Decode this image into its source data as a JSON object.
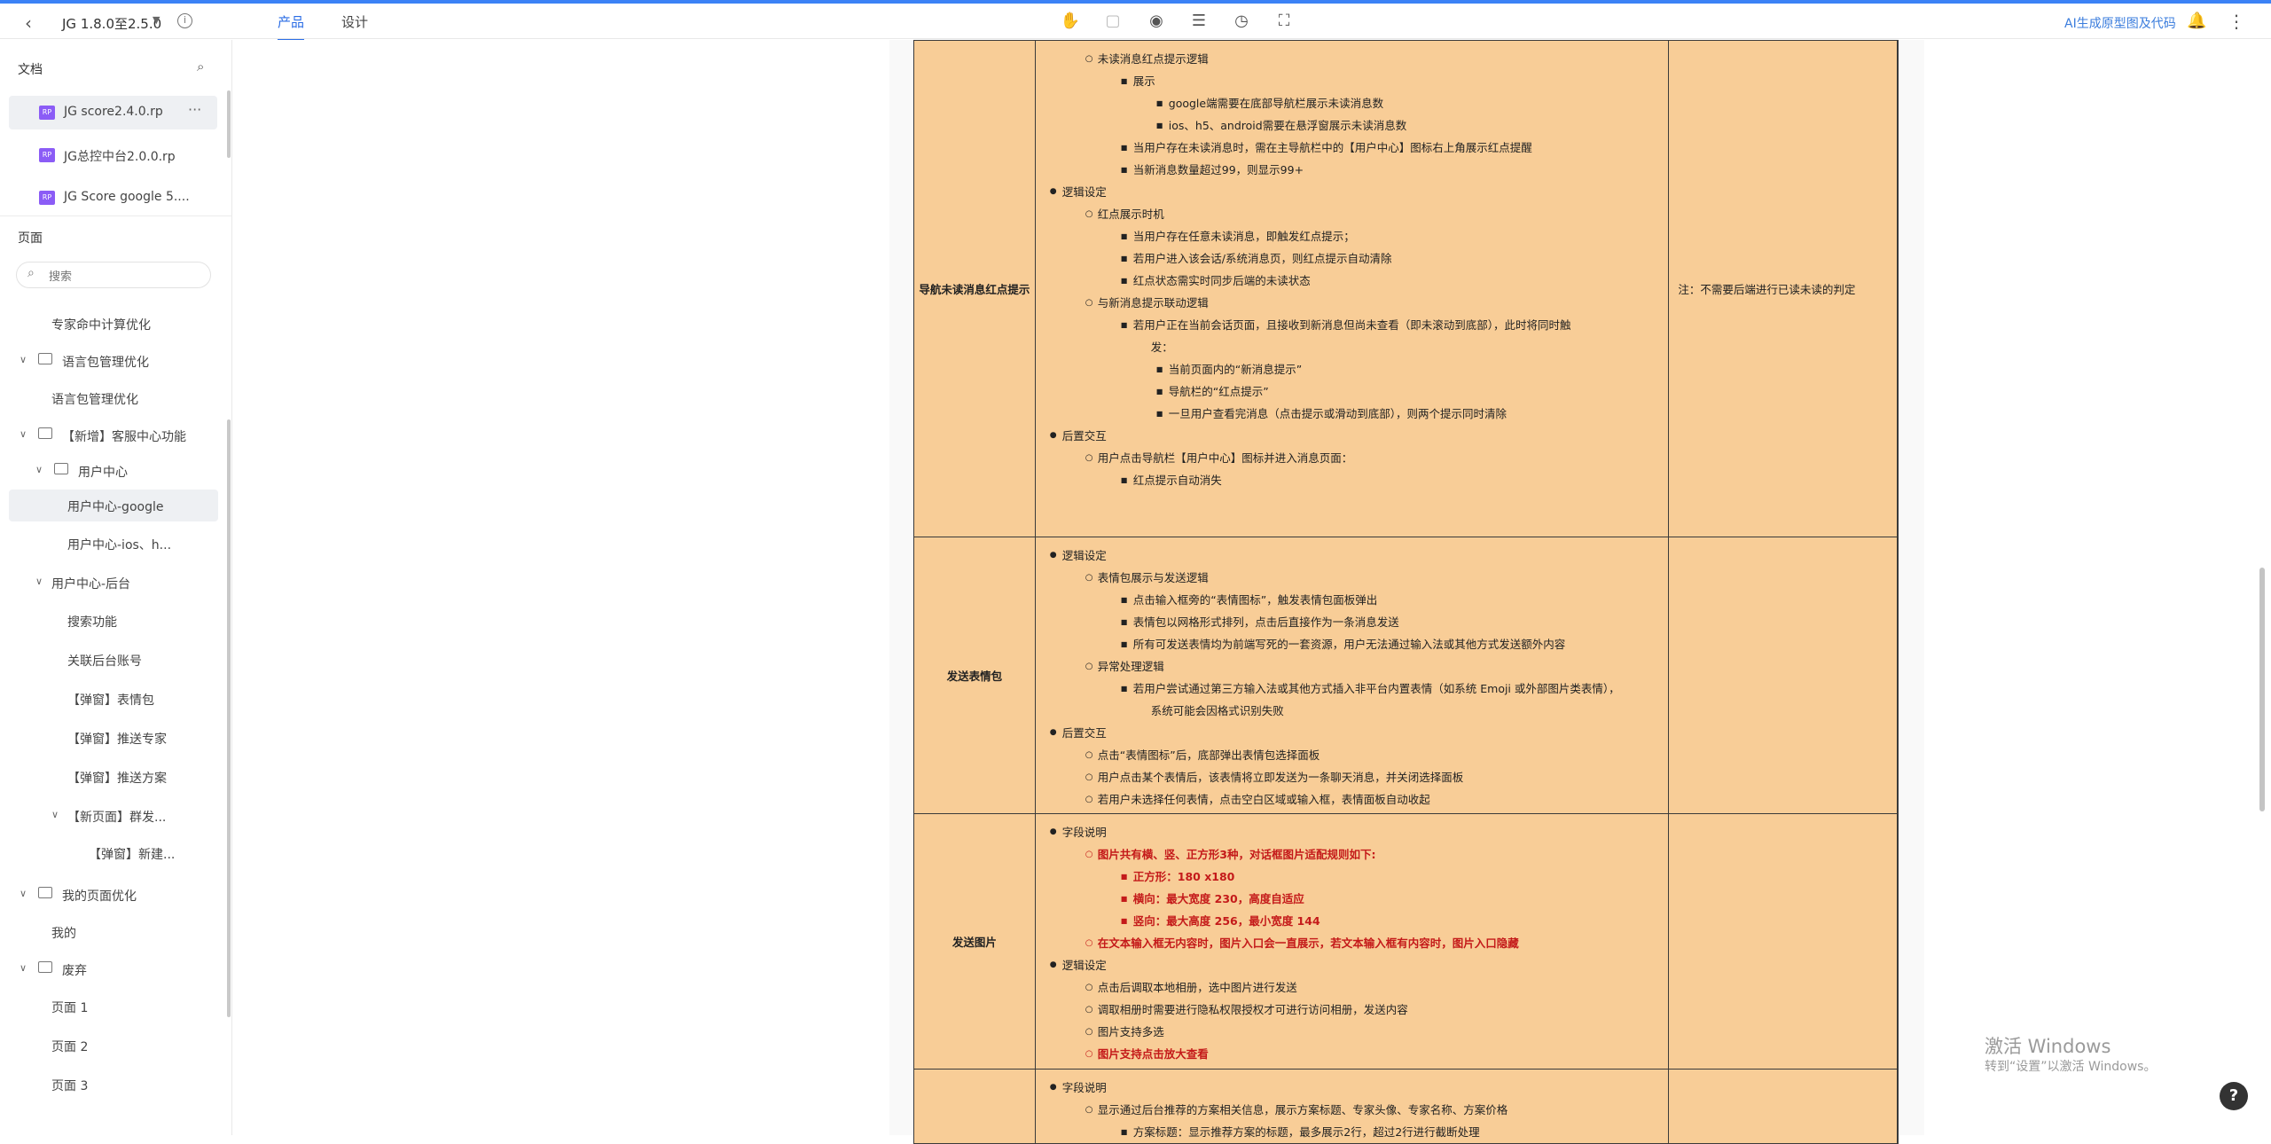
{
  "topbar": {
    "doc_title": "JG 1.8.0至2.5.0",
    "tabs": [
      "产品",
      "设计"
    ],
    "ai_link": "AI生成原型图及代码"
  },
  "sidebar": {
    "docs_heading": "文档",
    "files": [
      {
        "badge": "RP",
        "label": "JG score2.4.0.rp"
      },
      {
        "badge": "RP",
        "label": "JG总控中台2.0.0.rp"
      },
      {
        "badge": "RP",
        "label": "JG Score google 5...."
      }
    ],
    "pages_heading": "页面",
    "search_placeholder": "搜索",
    "tree": [
      {
        "label": "专家命中计算优化"
      },
      {
        "label": "语言包管理优化"
      },
      {
        "label": "语言包管理优化"
      },
      {
        "label": "【新增】客服中心功能"
      },
      {
        "label": "用户中心"
      },
      {
        "label": "用户中心-google"
      },
      {
        "label": "用户中心-ios、h..."
      },
      {
        "label": "用户中心-后台"
      },
      {
        "label": "搜索功能"
      },
      {
        "label": "关联后台账号"
      },
      {
        "label": "【弹窗】表情包"
      },
      {
        "label": "【弹窗】推送专家"
      },
      {
        "label": "【弹窗】推送方案"
      },
      {
        "label": "【新页面】群发..."
      },
      {
        "label": "【弹窗】新建..."
      },
      {
        "label": "我的页面优化"
      },
      {
        "label": "我的"
      },
      {
        "label": "废弃"
      },
      {
        "label": "页面 1"
      },
      {
        "label": "页面 2"
      },
      {
        "label": "页面 3"
      }
    ]
  },
  "table": {
    "rows": [
      {
        "name": "导航未读消息红点提示",
        "note": "注：不需要后端进行已读未读的判定",
        "lines": [
          {
            "lvl": 2,
            "text": "未读消息红点提示逻辑"
          },
          {
            "lvl": 3,
            "text": "展示"
          },
          {
            "lvl": 4,
            "text": "google端需要在底部导航栏展示未读消息数"
          },
          {
            "lvl": 4,
            "text": "ios、h5、android需要在悬浮窗展示未读消息数"
          },
          {
            "lvl": 3,
            "text": "当用户存在未读消息时，需在主导航栏中的【用户中心】图标右上角展示红点提醒"
          },
          {
            "lvl": 3,
            "text": "当新消息数量超过99，则显示99+"
          },
          {
            "lvl": 1,
            "text": "逻辑设定"
          },
          {
            "lvl": 2,
            "text": "红点展示时机"
          },
          {
            "lvl": 3,
            "text": "当用户存在任意未读消息，即触发红点提示；"
          },
          {
            "lvl": 3,
            "text": "若用户进入该会话/系统消息页，则红点提示自动清除"
          },
          {
            "lvl": 3,
            "text": "红点状态需实时同步后端的未读状态"
          },
          {
            "lvl": 2,
            "text": "与新消息提示联动逻辑"
          },
          {
            "lvl": 3,
            "text": "若用户正在当前会话页面，且接收到新消息但尚未查看（即未滚动到底部），此时将同时触"
          },
          {
            "lvl": 5,
            "text": "发："
          },
          {
            "lvl": 4,
            "text": "当前页面内的“新消息提示”"
          },
          {
            "lvl": 4,
            "text": "导航栏的“红点提示”"
          },
          {
            "lvl": 4,
            "text": "一旦用户查看完消息（点击提示或滑动到底部），则两个提示同时清除"
          },
          {
            "lvl": 1,
            "text": "后置交互"
          },
          {
            "lvl": 2,
            "text": "用户点击导航栏【用户中心】图标并进入消息页面："
          },
          {
            "lvl": 3,
            "text": "红点提示自动消失"
          }
        ]
      },
      {
        "name": "发送表情包",
        "note": "",
        "lines": [
          {
            "lvl": 1,
            "text": "逻辑设定"
          },
          {
            "lvl": 2,
            "text": "表情包展示与发送逻辑"
          },
          {
            "lvl": 3,
            "text": "点击输入框旁的“表情图标”，触发表情包面板弹出"
          },
          {
            "lvl": 3,
            "text": "表情包以网格形式排列，点击后直接作为一条消息发送"
          },
          {
            "lvl": 3,
            "text": "所有可发送表情均为前端写死的一套资源，用户无法通过输入法或其他方式发送额外内容"
          },
          {
            "lvl": 2,
            "text": "异常处理逻辑"
          },
          {
            "lvl": 3,
            "text": "若用户尝试通过第三方输入法或其他方式插入非平台内置表情（如系统 Emoji 或外部图片类表情），"
          },
          {
            "lvl": 5,
            "text": "系统可能会因格式识别失败"
          },
          {
            "lvl": 1,
            "text": "后置交互"
          },
          {
            "lvl": 2,
            "text": "点击“表情图标”后，底部弹出表情包选择面板"
          },
          {
            "lvl": 2,
            "text": "用户点击某个表情后，该表情将立即发送为一条聊天消息，并关闭选择面板"
          },
          {
            "lvl": 2,
            "text": "若用户未选择任何表情，点击空白区域或输入框，表情面板自动收起"
          }
        ]
      },
      {
        "name": "发送图片",
        "note": "",
        "lines": [
          {
            "lvl": 1,
            "text": "字段说明"
          },
          {
            "lvl": 2,
            "text": "图片共有横、竖、正方形3种，对话框图片适配规则如下:",
            "red": true
          },
          {
            "lvl": 3,
            "text": "正方形：180 x180",
            "red": true
          },
          {
            "lvl": 3,
            "text": "横向：最大宽度 230，高度自适应",
            "red": true
          },
          {
            "lvl": 3,
            "text": "竖向：最大高度 256，最小宽度 144",
            "red": true
          },
          {
            "lvl": 2,
            "text": "在文本输入框无内容时，图片入口会一直展示，若文本输入框有内容时，图片入口隐藏",
            "red": true
          },
          {
            "lvl": 1,
            "text": "逻辑设定"
          },
          {
            "lvl": 2,
            "text": "点击后调取本地相册，选中图片进行发送"
          },
          {
            "lvl": 2,
            "text": "调取相册时需要进行隐私权限授权才可进行访问相册，发送内容"
          },
          {
            "lvl": 2,
            "text": "图片支持多选"
          },
          {
            "lvl": 2,
            "text": "图片支持点击放大查看",
            "red": true
          }
        ]
      },
      {
        "name": "",
        "note": "",
        "lines": [
          {
            "lvl": 1,
            "text": "字段说明"
          },
          {
            "lvl": 2,
            "text": "显示通过后台推荐的方案相关信息，展示方案标题、专家头像、专家名称、方案价格"
          },
          {
            "lvl": 3,
            "text": "方案标题：显示推荐方案的标题，最多展示2行，超过2行进行截断处理"
          }
        ]
      }
    ]
  },
  "watermark": {
    "line1": "激活 Windows",
    "line2": "转到“设置”以激活 Windows。"
  },
  "help_label": "?"
}
